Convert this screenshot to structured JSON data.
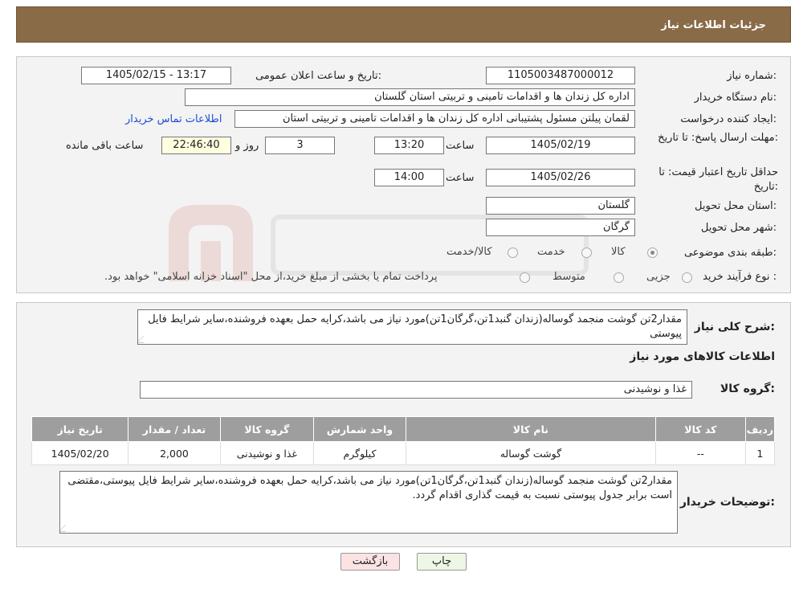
{
  "header": {
    "title": "جزئیات اطلاعات نیاز"
  },
  "form": {
    "need_number_label": "شماره نیاز:",
    "need_number": "1105003487000012",
    "announce_label": "تاریخ و ساعت اعلان عمومی:",
    "announce_value": "1405/02/15 - 13:17",
    "buyer_org_label": "نام دستگاه خریدار:",
    "buyer_org": "اداره کل زندان ها و اقدامات تامینی و تربیتی استان گلستان",
    "creator_label": "ایجاد کننده درخواست:",
    "creator": "لقمان پیلتن مسئول پشتیبانی اداره کل زندان ها و اقدامات تامینی و تربیتی استان",
    "contact_link": "اطلاعات تماس خریدار",
    "deadline_label": "مهلت ارسال پاسخ: تا تاریخ:",
    "deadline_date": "1405/02/19",
    "time_label": "ساعت",
    "deadline_time": "13:20",
    "days_value": "3",
    "days_label": "روز و",
    "remaining_time": "22:46:40",
    "remaining_label": "ساعت باقی مانده",
    "validity_label": "حداقل تاریخ اعتبار قیمت: تا تاریخ:",
    "validity_date": "1405/02/26",
    "validity_time": "14:00",
    "province_label": "استان محل تحویل:",
    "province": "گلستان",
    "city_label": "شهر محل تحویل:",
    "city": "گرگان",
    "category_label": "طبقه بندی موضوعی:",
    "category_options": [
      "کالا",
      "خدمت",
      "کالا/خدمت"
    ],
    "process_label": "نوع فرآیند خرید :",
    "process_options": [
      "جزیی",
      "متوسط"
    ],
    "process_note": "پرداخت تمام یا بخشی از مبلغ خرید،از محل \"اسناد خزانه اسلامی\" خواهد بود."
  },
  "summary": {
    "label": "شرح کلی نیاز:",
    "text": "مقدار2تن گوشت منجمد گوساله(زندان گنبد1تن،گرگان1تن)مورد نیاز می باشد،کرایه حمل بعهده فروشنده،سایر شرایط فایل پیوستی"
  },
  "goods_section": {
    "title": "اطلاعات کالاهای مورد نیاز",
    "group_label": "گروه کالا:",
    "group_value": "غذا و نوشیدنی"
  },
  "table": {
    "headers": [
      "ردیف",
      "کد کالا",
      "نام کالا",
      "واحد شمارش",
      "گروه کالا",
      "تعداد / مقدار",
      "تاریخ نیاز"
    ],
    "rows": [
      [
        "1",
        "--",
        "گوشت گوساله",
        "کیلوگرم",
        "غذا و نوشیدنی",
        "2,000",
        "1405/02/20"
      ]
    ]
  },
  "buyer_notes": {
    "label": "توضیحات خریدار:",
    "text": "مقدار2تن گوشت منجمد گوساله(زندان گنبد1تن،گرگان1تن)مورد نیاز می باشد،کرایه حمل بعهده فروشنده،سایر شرایط فایل پیوستی،مقتضی است برابر جدول پیوستی نسبت به قیمت گذاری اقدام گردد."
  },
  "buttons": {
    "print": "چاپ",
    "back": "بازگشت"
  },
  "colors": {
    "header": "#8a6b47",
    "table_header": "#9e9e9e",
    "link": "#1a4fd6"
  }
}
